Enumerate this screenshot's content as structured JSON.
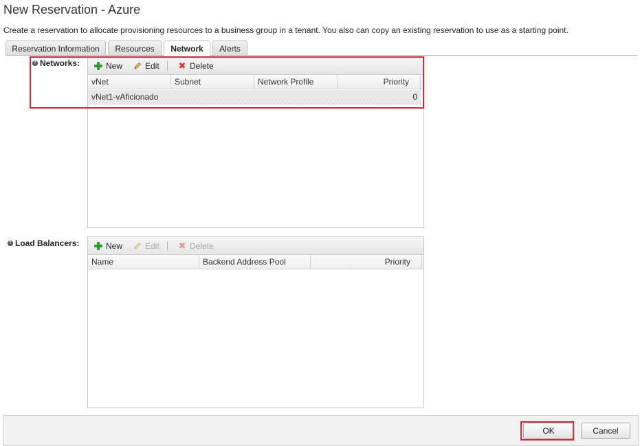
{
  "header": {
    "title": "New Reservation - Azure",
    "description": "Create a reservation to allocate provisioning resources to a business group in a tenant. You also can copy an existing reservation to use as a starting point."
  },
  "tabs": [
    {
      "label": "Reservation Information",
      "active": false
    },
    {
      "label": "Resources",
      "active": false
    },
    {
      "label": "Network",
      "active": true
    },
    {
      "label": "Alerts",
      "active": false
    }
  ],
  "networks": {
    "label": "Networks:",
    "toolbar": {
      "new": "New",
      "edit": "Edit",
      "delete": "Delete"
    },
    "columns": [
      "vNet",
      "Subnet",
      "Network Profile",
      "Priority"
    ],
    "rows": [
      {
        "vnet": "vNet1-vAficionado",
        "subnet": "",
        "network_profile": "",
        "priority": "0"
      }
    ]
  },
  "load_balancers": {
    "label": "Load Balancers:",
    "toolbar": {
      "new": "New",
      "edit": "Edit",
      "delete": "Delete"
    },
    "columns": [
      "Name",
      "Backend Address Pool",
      "Priority"
    ],
    "rows": []
  },
  "footer": {
    "ok": "OK",
    "cancel": "Cancel"
  },
  "colors": {
    "highlight": "#e2262b",
    "add_icon": "#2e9b2e",
    "delete_icon": "#d33a2c"
  }
}
